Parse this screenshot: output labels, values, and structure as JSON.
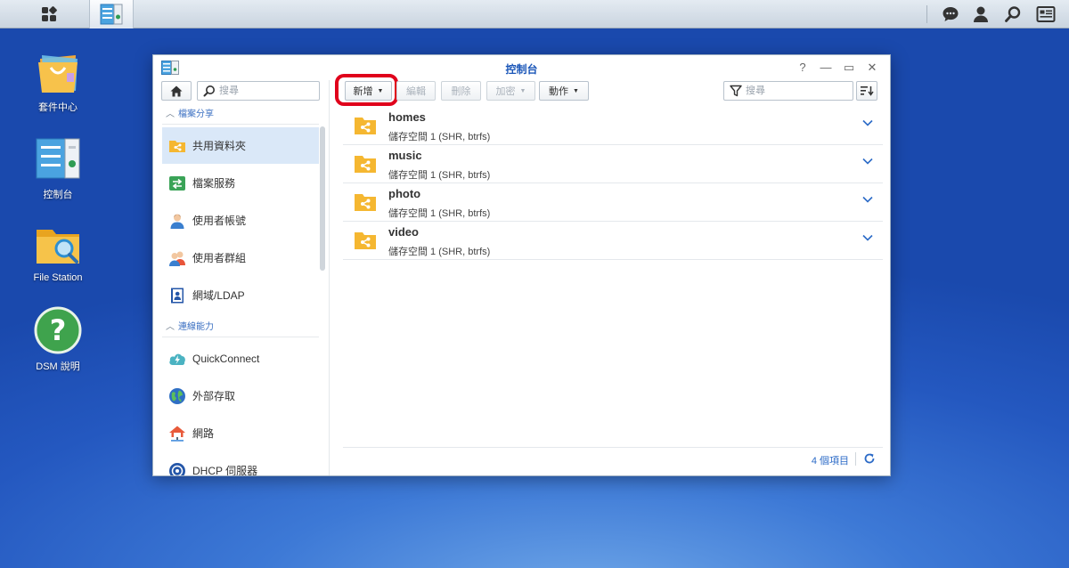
{
  "desktop": {
    "icons": [
      {
        "label": "套件中心"
      },
      {
        "label": "控制台"
      },
      {
        "label": "File Station"
      },
      {
        "label": "DSM 說明"
      }
    ]
  },
  "window": {
    "title": "控制台",
    "help_glyph": "?",
    "minimize_glyph": "—",
    "maximize_glyph": "▭",
    "close_glyph": "✕"
  },
  "sidebar": {
    "search_placeholder": "搜尋",
    "sections": [
      {
        "title": "檔案分享",
        "items": [
          {
            "label": "共用資料夾",
            "icon": "shared-folder-icon",
            "active": true
          },
          {
            "label": "檔案服務",
            "icon": "file-services-icon"
          },
          {
            "label": "使用者帳號",
            "icon": "user-icon"
          },
          {
            "label": "使用者群組",
            "icon": "group-icon"
          },
          {
            "label": "網域/LDAP",
            "icon": "domain-ldap-icon"
          }
        ]
      },
      {
        "title": "連線能力",
        "items": [
          {
            "label": "QuickConnect",
            "icon": "quickconnect-icon"
          },
          {
            "label": "外部存取",
            "icon": "external-access-icon"
          },
          {
            "label": "網路",
            "icon": "network-icon"
          },
          {
            "label": "DHCP 伺服器",
            "icon": "dhcp-server-icon"
          }
        ]
      }
    ]
  },
  "toolbar": {
    "create_label": "新增",
    "edit_label": "編輯",
    "delete_label": "刪除",
    "encrypt_label": "加密",
    "action_label": "動作",
    "filter_placeholder": "搜尋"
  },
  "shared_folders": [
    {
      "name": "homes",
      "description": "儲存空間 1 (SHR, btrfs)"
    },
    {
      "name": "music",
      "description": "儲存空間 1 (SHR, btrfs)"
    },
    {
      "name": "photo",
      "description": "儲存空間 1 (SHR, btrfs)"
    },
    {
      "name": "video",
      "description": "儲存空間 1 (SHR, btrfs)"
    }
  ],
  "footer": {
    "item_count": "4 個項目"
  },
  "colors": {
    "accent": "#2c6bc7",
    "folder": "#f5b731",
    "highlight": "#e0001b",
    "active_row": "#dae8f8"
  }
}
